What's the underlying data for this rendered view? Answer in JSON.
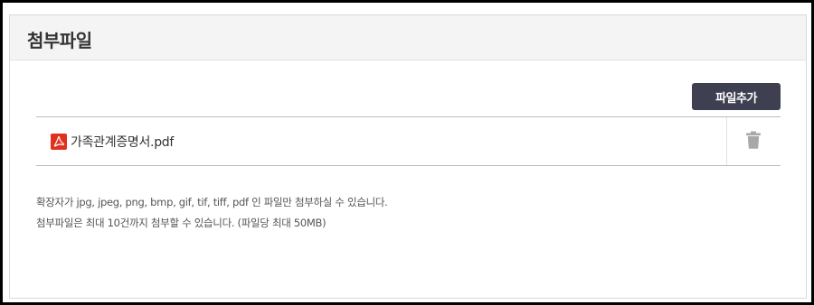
{
  "section": {
    "title": "첨부파일"
  },
  "toolbar": {
    "add_file_label": "파일추가"
  },
  "files": [
    {
      "name": "가족관계증명서.pdf",
      "icon": "pdf-icon"
    }
  ],
  "notices": [
    "확장자가 jpg, jpeg, png, bmp, gif, tif, tiff, pdf 인 파일만 첨부하실 수 있습니다.",
    "첨부파일은 최대 10건까지 첨부할 수 있습니다. (파일당 최대 50MB)"
  ],
  "colors": {
    "button_bg": "#3f3f52",
    "pdf_red": "#e0301e",
    "header_bg": "#f4f4f4"
  }
}
